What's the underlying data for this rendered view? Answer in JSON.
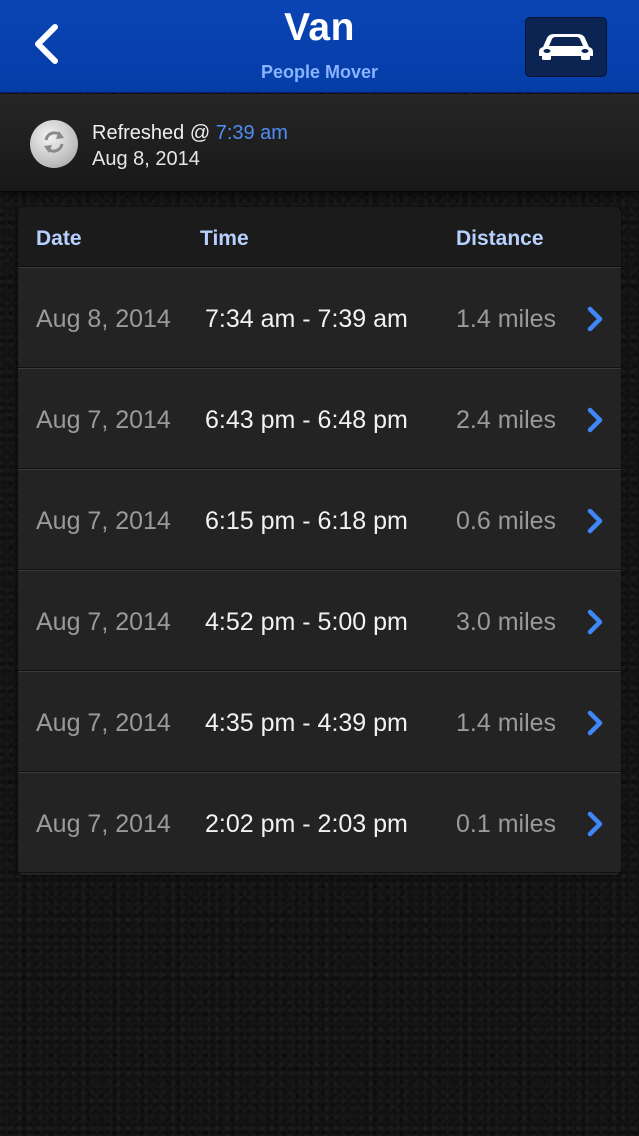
{
  "header": {
    "title": "Van",
    "subtitle": "People Mover"
  },
  "refresh": {
    "label": "Refreshed @",
    "time": "7:39 am",
    "date": "Aug 8, 2014"
  },
  "table": {
    "columns": [
      "Date",
      "Time",
      "Distance"
    ],
    "rows": [
      {
        "date": "Aug 8, 2014",
        "time": "7:34 am - 7:39 am",
        "distance": "1.4 miles"
      },
      {
        "date": "Aug 7, 2014",
        "time": "6:43 pm - 6:48 pm",
        "distance": "2.4 miles"
      },
      {
        "date": "Aug 7, 2014",
        "time": "6:15 pm - 6:18 pm",
        "distance": "0.6 miles"
      },
      {
        "date": "Aug 7, 2014",
        "time": "4:52 pm - 5:00 pm",
        "distance": "3.0 miles"
      },
      {
        "date": "Aug 7, 2014",
        "time": "4:35 pm - 4:39 pm",
        "distance": "1.4 miles"
      },
      {
        "date": "Aug 7, 2014",
        "time": "2:02 pm - 2:03 pm",
        "distance": "0.1 miles"
      }
    ]
  },
  "icons": {
    "back": "chevron-left-icon",
    "vehicle": "car-icon",
    "refresh": "refresh-icon",
    "row_disclosure": "chevron-right-icon"
  },
  "colors": {
    "navbar": "#0a45b4",
    "accent": "#4f8df7",
    "header_text": "#b7d0ff"
  }
}
